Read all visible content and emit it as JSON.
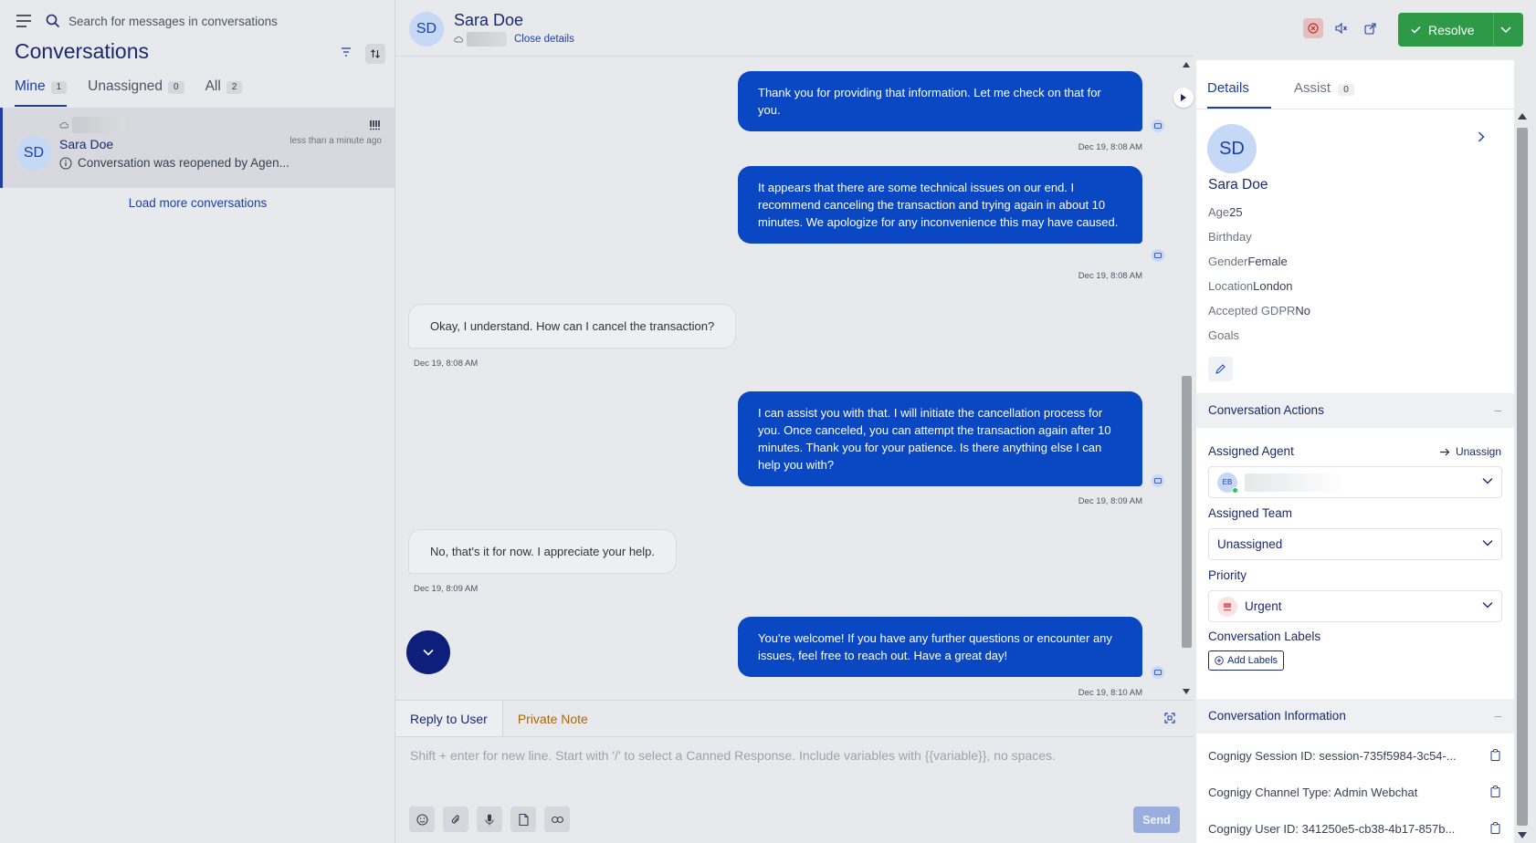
{
  "left_panel": {
    "search_placeholder": "Search for messages in conversations",
    "title": "Conversations",
    "tabs": [
      {
        "label": "Mine",
        "count": "1"
      },
      {
        "label": "Unassigned",
        "count": "0"
      },
      {
        "label": "All",
        "count": "2"
      }
    ],
    "conversation": {
      "avatar_initials": "SD",
      "name": "Sara Doe",
      "time": "less than a minute ago",
      "preview": "Conversation was reopened by Agen..."
    },
    "load_more": "Load more conversations"
  },
  "header": {
    "avatar_initials": "SD",
    "name": "Sara Doe",
    "close_details": "Close details",
    "resolve_label": "Resolve"
  },
  "messages": [
    {
      "direction": "out",
      "text": "Thank you for providing that information. Let me check on that for you.",
      "time": "Dec 19, 8:08 AM"
    },
    {
      "direction": "out",
      "text": "It appears that there are some technical issues on our end. I recommend canceling the transaction and trying again in about 10 minutes. We apologize for any inconvenience this may have caused.",
      "time": "Dec 19, 8:08 AM"
    },
    {
      "direction": "in",
      "text": "Okay, I understand. How can I cancel the transaction?",
      "time": "Dec 19, 8:08 AM"
    },
    {
      "direction": "out",
      "text": "I can assist you with that. I will initiate the cancellation process for you. Once canceled, you can attempt the transaction again after 10 minutes. Thank you for your patience. Is there anything else I can help you with?",
      "time": "Dec 19, 8:09 AM"
    },
    {
      "direction": "in",
      "text": "No, that's it for now. I appreciate your help.",
      "time": "Dec 19, 8:09 AM"
    },
    {
      "direction": "out",
      "text": "You're welcome! If you have any further questions or encounter any issues, feel free to reach out. Have a great day!",
      "time": "Dec 19, 8:10 AM"
    }
  ],
  "composer": {
    "reply_tab": "Reply to User",
    "note_tab": "Private Note",
    "placeholder": "Shift + enter for new line. Start with '/' to select a Canned Response. Include variables with {{variable}}, no spaces.",
    "send_label": "Send"
  },
  "right_panel": {
    "tabs": {
      "details": "Details",
      "assist": "Assist",
      "assist_count": "0"
    },
    "avatar_initials": "SD",
    "name": "Sara Doe",
    "attributes": [
      {
        "label": "Age",
        "value": "25"
      },
      {
        "label": "Birthday",
        "value": ""
      },
      {
        "label": "Gender",
        "value": "Female"
      },
      {
        "label": "Location",
        "value": "London"
      },
      {
        "label": "Accepted GDPR",
        "value": "No"
      },
      {
        "label": "Goals",
        "value": ""
      }
    ],
    "actions_title": "Conversation Actions",
    "assigned_agent_label": "Assigned Agent",
    "unassign_label": "Unassign",
    "agent_initials": "EB",
    "assigned_team_label": "Assigned Team",
    "assigned_team_value": "Unassigned",
    "priority_label": "Priority",
    "priority_value": "Urgent",
    "labels_title": "Conversation Labels",
    "add_labels": "Add Labels",
    "info_title": "Conversation Information",
    "info_rows": [
      "Cognigy Session ID: session-735f5984-3c54-...",
      "Cognigy Channel Type: Admin Webchat",
      "Cognigy User ID: 341250e5-cb38-4b17-857b..."
    ]
  },
  "colors": {
    "brand": "#1d3fa6",
    "outgoing_bubble": "#0a47c2",
    "resolve": "#2e9a47",
    "private_note": "#a8670a"
  }
}
